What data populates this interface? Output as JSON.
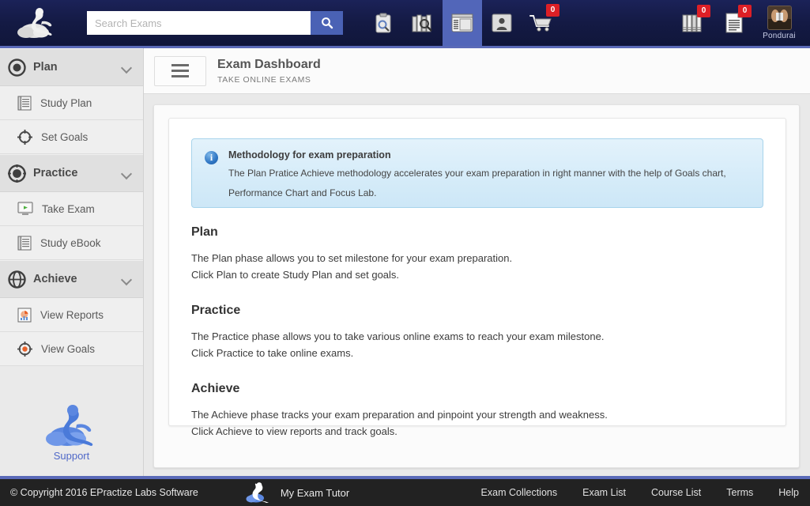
{
  "topbar": {
    "logo_icon": "person-on-cloud-logo",
    "search": {
      "placeholder": "Search Exams",
      "value": "",
      "button_icon": "search-icon"
    },
    "nav_icons": [
      {
        "name": "clipboard-search-icon",
        "label": "Exam Review",
        "active": false
      },
      {
        "name": "books-search-icon",
        "label": "Exam Collections",
        "active": false
      },
      {
        "name": "window-list-icon",
        "label": "Exam Dashboard",
        "active": true
      },
      {
        "name": "user-card-icon",
        "label": "Profile",
        "active": false
      }
    ],
    "cart": {
      "icon": "shopping-cart-icon",
      "badge": "0"
    },
    "right_icons": [
      {
        "name": "books-icon",
        "badge": "0"
      },
      {
        "name": "notes-icon",
        "badge": "0"
      }
    ],
    "profile": {
      "name": "Pondurai",
      "avatar_icon": "user-avatar-photo"
    }
  },
  "sidebar": {
    "groups": [
      {
        "label": "Plan",
        "icon": "target-ring-icon",
        "chevron": "chevron-down-icon",
        "items": [
          {
            "label": "Study Plan",
            "icon": "document-lines-icon"
          },
          {
            "label": "Set Goals",
            "icon": "crosshair-icon"
          }
        ]
      },
      {
        "label": "Practice",
        "icon": "target-filled-icon",
        "chevron": "chevron-down-icon",
        "items": [
          {
            "label": "Take Exam",
            "icon": "monitor-play-icon"
          },
          {
            "label": "Study eBook",
            "icon": "document-lines-icon"
          }
        ]
      },
      {
        "label": "Achieve",
        "icon": "globe-target-icon",
        "chevron": "chevron-down-icon",
        "items": [
          {
            "label": "View Reports",
            "icon": "report-chart-icon"
          },
          {
            "label": "View Goals",
            "icon": "target-orange-icon"
          }
        ]
      }
    ],
    "support": {
      "label": "Support",
      "icon": "support-cloud-icon"
    }
  },
  "header": {
    "menu_icon": "hamburger-menu-icon",
    "title": "Exam Dashboard",
    "subtitle": "TAKE ONLINE EXAMS"
  },
  "alert": {
    "icon": "info-icon",
    "icon_glyph": "i",
    "title": "Methodology for exam preparation",
    "text": "The Plan Pratice Achieve methodology accelerates your exam preparation in right manner with the help of Goals chart, Performance Chart and Focus Lab."
  },
  "sections": [
    {
      "heading": "Plan",
      "line1": "The Plan phase allows you to set milestone for your exam preparation.",
      "line2": "Click Plan to create Study Plan and set goals."
    },
    {
      "heading": "Practice",
      "line1": "The Practice phase allows you to take various online exams to reach your exam milestone.",
      "line2": "Click Practice to take online exams."
    },
    {
      "heading": "Achieve",
      "line1": "The Achieve phase tracks your exam preparation and pinpoint your strength and weakness.",
      "line2": "Click Achieve to view reports and track goals."
    }
  ],
  "footer": {
    "copyright": "© Copyright 2016 EPractize Labs Software",
    "brand": "My Exam Tutor",
    "brand_icon": "person-on-cloud-logo",
    "links": [
      {
        "label": "Exam Collections"
      },
      {
        "label": "Exam List"
      },
      {
        "label": "Course List"
      },
      {
        "label": "Terms"
      },
      {
        "label": "Help"
      }
    ]
  },
  "colors": {
    "topbar": "#151b42",
    "accent": "#5a6ab8",
    "active_tab": "#5266b9",
    "badge": "#dd1f26",
    "search_button": "#4a62b5",
    "footer": "#222222",
    "support_link": "#5069c8"
  }
}
